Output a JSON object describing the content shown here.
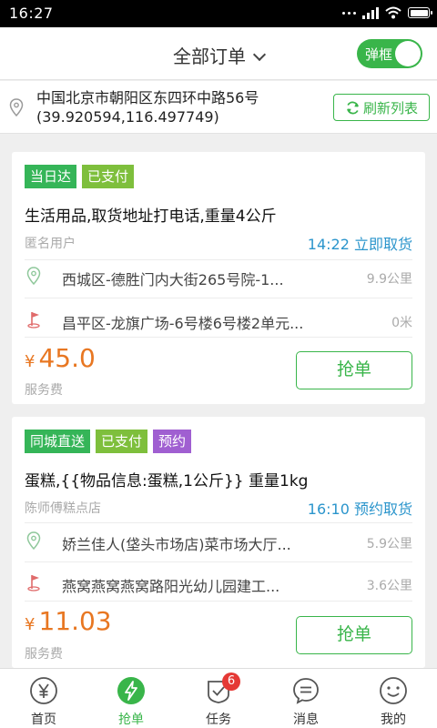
{
  "status_bar": {
    "time": "16:27"
  },
  "header": {
    "title": "全部订单",
    "toggle_label": "弹框",
    "toggle_on": true
  },
  "location": {
    "address_line": "中国北京市朝阳区东四环中路56号",
    "coords_line": "(39.920594,116.497749)",
    "refresh_label": "刷新列表"
  },
  "orders": [
    {
      "tags": [
        "当日达",
        "已支付"
      ],
      "description": "生活用品,取货地址打电话,重量4公斤",
      "shop": "匿名用户",
      "pickup_time": "14:22 立即取货",
      "from_address": "西城区-德胜门内大街265号院-1...",
      "from_distance": "9.9公里",
      "to_address": "昌平区-龙旗广场-6号楼6号楼2单元...",
      "to_distance": "0米",
      "currency": "¥",
      "price": "45.0",
      "fee_label": "服务费",
      "grab_label": "抢单"
    },
    {
      "tags": [
        "同城直送",
        "已支付",
        "预约"
      ],
      "description": "蛋糕,{{物品信息:蛋糕,1公斤}} 重量1kg",
      "shop": "陈师傅糕点店",
      "pickup_time": "16:10 预约取货",
      "from_address": "娇兰佳人(垡头市场店)菜市场大厅...",
      "from_distance": "5.9公里",
      "to_address": "燕窝燕窝燕窝路阳光幼儿园建工...",
      "to_distance": "3.6公里",
      "currency": "¥",
      "price": "11.03",
      "fee_label": "服务费",
      "grab_label": "抢单"
    }
  ],
  "tabbar": {
    "items": [
      {
        "label": "首页",
        "icon": "yen-icon"
      },
      {
        "label": "抢单",
        "icon": "lightning-icon"
      },
      {
        "label": "任务",
        "icon": "task-check-icon",
        "badge": "6"
      },
      {
        "label": "消息",
        "icon": "message-icon"
      },
      {
        "label": "我的",
        "icon": "smiley-icon"
      }
    ],
    "active_index": 1
  },
  "colors": {
    "brand_green": "#39b54a",
    "price_orange": "#e87722",
    "time_blue": "#2b95cc",
    "badge_red": "#e53935"
  }
}
